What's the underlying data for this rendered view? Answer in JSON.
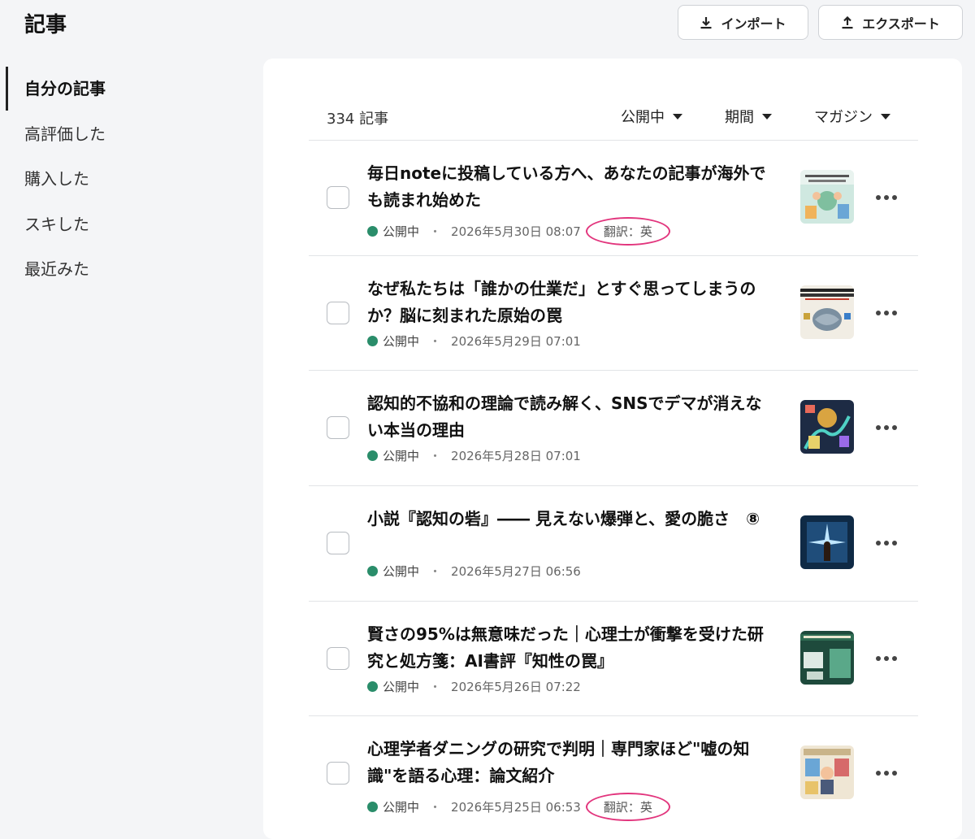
{
  "page": {
    "title": "記事"
  },
  "actions": {
    "import_label": "インポート",
    "export_label": "エクスポート"
  },
  "sidebar": {
    "items": [
      {
        "label": "自分の記事",
        "active": true
      },
      {
        "label": "高評価した"
      },
      {
        "label": "購入した"
      },
      {
        "label": "スキした"
      },
      {
        "label": "最近みた"
      }
    ]
  },
  "list": {
    "count": "334 記事",
    "filters": {
      "status": "公開中",
      "period": "期間",
      "magazine": "マガジン"
    },
    "articles": [
      {
        "title": "毎日noteに投稿している方へ、あなたの記事が海外でも読まれ始めた",
        "status": "公開中",
        "date": "2026年5月30日 08:07",
        "translation": "翻訳：英"
      },
      {
        "title": "なぜ私たちは「誰かの仕業だ」とすぐ思ってしまうのか？脳に刻まれた原始の罠",
        "status": "公開中",
        "date": "2026年5月29日 07:01"
      },
      {
        "title": "認知的不協和の理論で読み解く、SNSでデマが消えない本当の理由",
        "status": "公開中",
        "date": "2026年5月28日 07:01"
      },
      {
        "title": "小説『認知の砦』―― 見えない爆弾と、愛の脆さ　⑧",
        "status": "公開中",
        "date": "2026年5月27日 06:56"
      },
      {
        "title": "賢さの95%は無意味だった｜心理士が衝撃を受けた研究と処方箋：AI書評『知性の罠』",
        "status": "公開中",
        "date": "2026年5月26日 07:22"
      },
      {
        "title": "心理学者ダニングの研究で判明｜専門家ほど\"嘘の知識\"を語る心理：論文紹介",
        "status": "公開中",
        "date": "2026年5月25日 06:53",
        "translation": "翻訳：英"
      }
    ]
  },
  "colors": {
    "status_green": "#2a8d6a",
    "highlight_pink": "#e2357d"
  }
}
